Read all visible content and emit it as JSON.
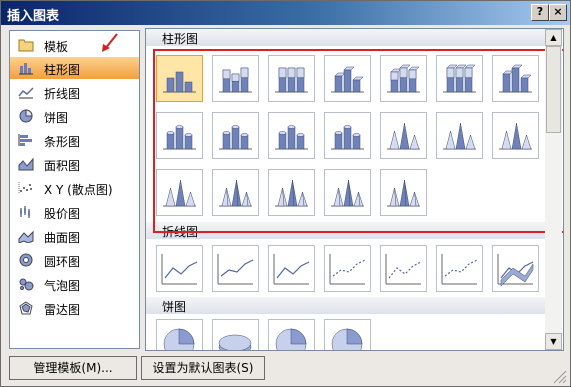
{
  "window": {
    "title": "插入图表",
    "help_label": "?",
    "close_label": "×"
  },
  "left_panel": {
    "items": [
      {
        "label": "模板",
        "icon": "folder-icon"
      },
      {
        "label": "柱形图",
        "icon": "column-chart-icon",
        "selected": true
      },
      {
        "label": "折线图",
        "icon": "line-chart-icon"
      },
      {
        "label": "饼图",
        "icon": "pie-chart-icon"
      },
      {
        "label": "条形图",
        "icon": "bar-chart-icon"
      },
      {
        "label": "面积图",
        "icon": "area-chart-icon"
      },
      {
        "label": "X Y (散点图)",
        "icon": "scatter-chart-icon"
      },
      {
        "label": "股价图",
        "icon": "stock-chart-icon"
      },
      {
        "label": "曲面图",
        "icon": "surface-chart-icon"
      },
      {
        "label": "圆环图",
        "icon": "doughnut-chart-icon"
      },
      {
        "label": "气泡图",
        "icon": "bubble-chart-icon"
      },
      {
        "label": "雷达图",
        "icon": "radar-chart-icon"
      }
    ]
  },
  "gallery": {
    "sections": [
      {
        "label": "柱形图"
      },
      {
        "label": "折线图"
      },
      {
        "label": "饼图"
      }
    ],
    "thumbnails": {
      "column": [
        "clustered-column-icon",
        "stacked-column-icon",
        "100-stacked-column-icon",
        "3d-clustered-column-icon",
        "3d-stacked-column-icon",
        "3d-100-stacked-column-icon",
        "3d-column-icon",
        "clustered-cylinder-icon",
        "stacked-cylinder-icon",
        "100-stacked-cylinder-icon",
        "3d-cylinder-icon",
        "clustered-cone-icon",
        "stacked-cone-icon",
        "100-stacked-cone-icon",
        "3d-cone-icon",
        "clustered-pyramid-icon",
        "stacked-pyramid-icon",
        "100-stacked-pyramid-icon",
        "3d-pyramid-icon"
      ],
      "line": [
        "line-icon",
        "stacked-line-icon",
        "100-stacked-line-icon",
        "line-markers-icon",
        "stacked-line-markers-icon",
        "100-stacked-line-markers-icon",
        "3d-line-icon"
      ],
      "pie": [
        "pie-icon",
        "3d-pie-icon",
        "pie-of-pie-icon",
        "exploded-pie-icon"
      ]
    }
  },
  "buttons": {
    "manage_templates": "管理模板(M)...",
    "set_default": "设置为默认图表(S)"
  },
  "colors": {
    "selection": "#f49f3d",
    "highlight_box": "#e02020",
    "title_bar": "#0a246a"
  }
}
